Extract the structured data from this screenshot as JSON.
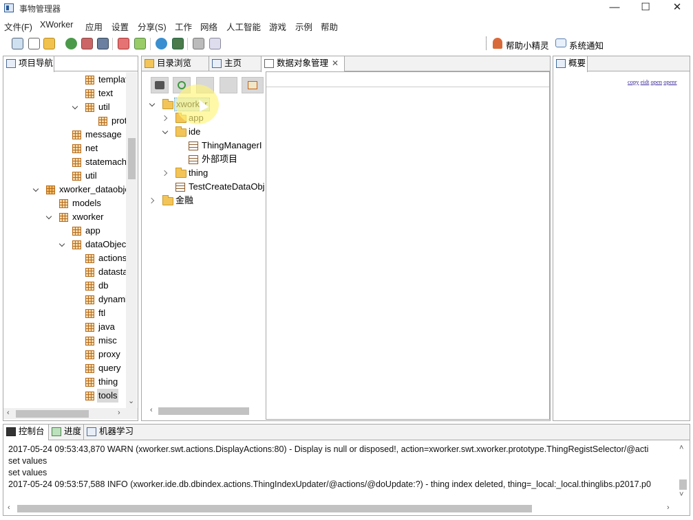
{
  "window": {
    "title": "事物管理器",
    "min": "—",
    "max": "☐",
    "close": "✕"
  },
  "menu": [
    "文件(F)",
    "XWorker",
    "应用",
    "设置",
    "分享(S)",
    "工作",
    "网络",
    "人工智能",
    "游戏",
    "示例",
    "帮助"
  ],
  "toolbar_right": {
    "helper": "帮助小精灵",
    "notify": "系统通知"
  },
  "nav_panel": {
    "tab": "项目导航",
    "items": [
      {
        "label": "templates",
        "level": 3,
        "icon": "package-icon",
        "twist": "none"
      },
      {
        "label": "text",
        "level": 3,
        "icon": "package-icon",
        "twist": "none"
      },
      {
        "label": "util",
        "level": 3,
        "icon": "package-icon",
        "twist": "open"
      },
      {
        "label": "protot",
        "level": 4,
        "icon": "package-icon",
        "twist": "none"
      },
      {
        "label": "message",
        "level": 2,
        "icon": "package-icon",
        "twist": "none"
      },
      {
        "label": "net",
        "level": 2,
        "icon": "package-icon",
        "twist": "none"
      },
      {
        "label": "statemachine",
        "level": 2,
        "icon": "package-icon",
        "twist": "none"
      },
      {
        "label": "util",
        "level": 2,
        "icon": "package-icon",
        "twist": "none"
      },
      {
        "label": "xworker_dataobject",
        "level": 0,
        "icon": "project-icon",
        "twist": "open"
      },
      {
        "label": "models",
        "level": 1,
        "icon": "package-icon",
        "twist": "none"
      },
      {
        "label": "xworker",
        "level": 1,
        "icon": "package-icon",
        "twist": "open"
      },
      {
        "label": "app",
        "level": 2,
        "icon": "package-icon",
        "twist": "none"
      },
      {
        "label": "dataObject",
        "level": 2,
        "icon": "package-icon",
        "twist": "open"
      },
      {
        "label": "actions",
        "level": 3,
        "icon": "package-icon",
        "twist": "none"
      },
      {
        "label": "datastax",
        "level": 3,
        "icon": "package-icon",
        "twist": "none"
      },
      {
        "label": "db",
        "level": 3,
        "icon": "package-icon",
        "twist": "none"
      },
      {
        "label": "dynamic",
        "level": 3,
        "icon": "package-icon",
        "twist": "none"
      },
      {
        "label": "ftl",
        "level": 3,
        "icon": "package-icon",
        "twist": "none"
      },
      {
        "label": "java",
        "level": 3,
        "icon": "package-icon",
        "twist": "none"
      },
      {
        "label": "misc",
        "level": 3,
        "icon": "package-icon",
        "twist": "none"
      },
      {
        "label": "proxy",
        "level": 3,
        "icon": "package-icon",
        "twist": "none"
      },
      {
        "label": "query",
        "level": 3,
        "icon": "package-icon",
        "twist": "none"
      },
      {
        "label": "thing",
        "level": 3,
        "icon": "package-icon",
        "twist": "none"
      },
      {
        "label": "tools",
        "level": 3,
        "icon": "package-icon",
        "twist": "none",
        "selected": true
      }
    ]
  },
  "center_panel": {
    "tabs": [
      "目录浏览",
      "主页",
      "数据对象管理"
    ],
    "tree": [
      {
        "label": "xworker",
        "level": 0,
        "icon": "folder-icon",
        "twist": "open",
        "selected": true
      },
      {
        "label": "app",
        "level": 1,
        "icon": "folder-icon",
        "twist": "closed"
      },
      {
        "label": "ide",
        "level": 1,
        "icon": "folder-icon",
        "twist": "open"
      },
      {
        "label": "ThingManagerI",
        "level": 2,
        "icon": "table-icon",
        "twist": "none"
      },
      {
        "label": "外部项目",
        "level": 2,
        "icon": "table-icon",
        "twist": "none"
      },
      {
        "label": "thing",
        "level": 1,
        "icon": "folder-icon",
        "twist": "closed"
      },
      {
        "label": "TestCreateDataObj",
        "level": 1,
        "icon": "table-icon",
        "twist": "none"
      },
      {
        "label": "金融",
        "level": 0,
        "icon": "folder-icon",
        "twist": "closed"
      }
    ]
  },
  "right_panel": {
    "tab": "概要",
    "links": [
      "copy",
      "eidt",
      "open",
      "openr"
    ]
  },
  "bottom_panel": {
    "tabs": [
      "控制台",
      "进度",
      "机器学习"
    ],
    "log": [
      "2017-05-24 09:53:43,870  WARN (xworker.swt.actions.DisplayActions:80) - Display is null or disposed!, action=xworker.swt.xworker.prototype.ThingRegistSelector/@acti",
      "set values",
      "set values",
      "2017-05-24 09:53:57,588  INFO (xworker.ide.db.dbindex.actions.ThingIndexUpdater/@actions/@doUpdate:?) - thing index deleted, thing=_local:_local.thinglibs.p2017.p0"
    ]
  }
}
